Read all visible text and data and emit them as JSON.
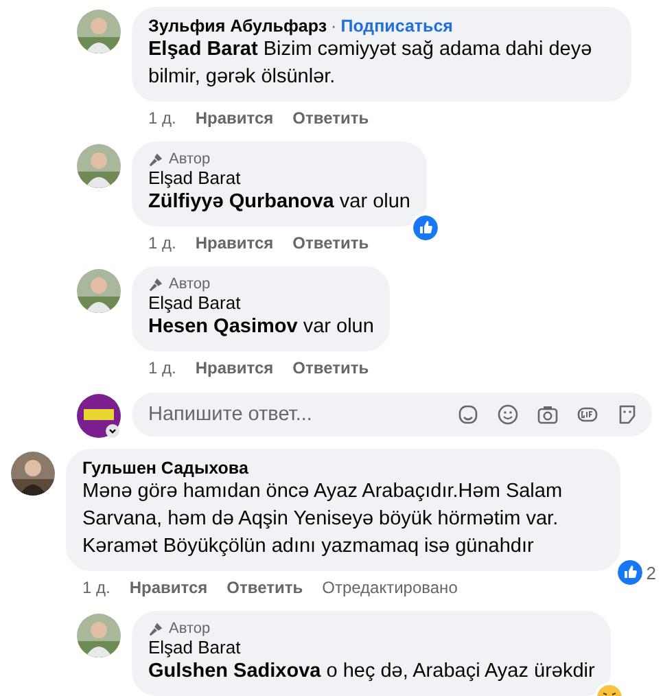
{
  "replies": [
    {
      "author": "Зульфия Абульфарз",
      "separator": "·",
      "follow_link": "Подписаться",
      "text": "**Elşad Barat** Bizim cəmiyyət sağ adama dahi deyə bilmir, gərək ölsünlər.",
      "meta": {
        "time": "1 д.",
        "like": "Нравится",
        "reply": "Ответить"
      }
    },
    {
      "badge": "Автор",
      "author": "Elşad Barat",
      "text": "**Zülfiyyə Qurbanova** var olun",
      "reaction": {
        "kind": "like"
      },
      "meta": {
        "time": "1 д.",
        "like": "Нравится",
        "reply": "Ответить"
      }
    },
    {
      "badge": "Автор",
      "author": "Elşad Barat",
      "text": "**Hesen Qasimov** var olun",
      "meta": {
        "time": "1 д.",
        "like": "Нравится",
        "reply": "Ответить"
      }
    }
  ],
  "reply_input": {
    "placeholder": "Напишите ответ..."
  },
  "comments": [
    {
      "author": "Гульшен Садыхова",
      "text": "Mənə görə hamıdan öncə Ayaz Arabaçıdır.Həm Salam Sarvana, həm də Aqşin Yeniseyə böyük hörmətim var. Kəramət Böyükçölün adını yazmamaq isə günahdır",
      "reaction": {
        "kind": "like",
        "count": "2"
      },
      "meta": {
        "time": "1 д.",
        "like": "Нравится",
        "reply": "Ответить",
        "edited": "Отредактировано"
      },
      "children": [
        {
          "badge": "Автор",
          "author": "Elşad Barat",
          "text": "**Gulshen Sadixova** o heç də, Arabaçi Ayaz ürəkdir",
          "reaction": {
            "kind": "haha"
          }
        }
      ]
    }
  ]
}
